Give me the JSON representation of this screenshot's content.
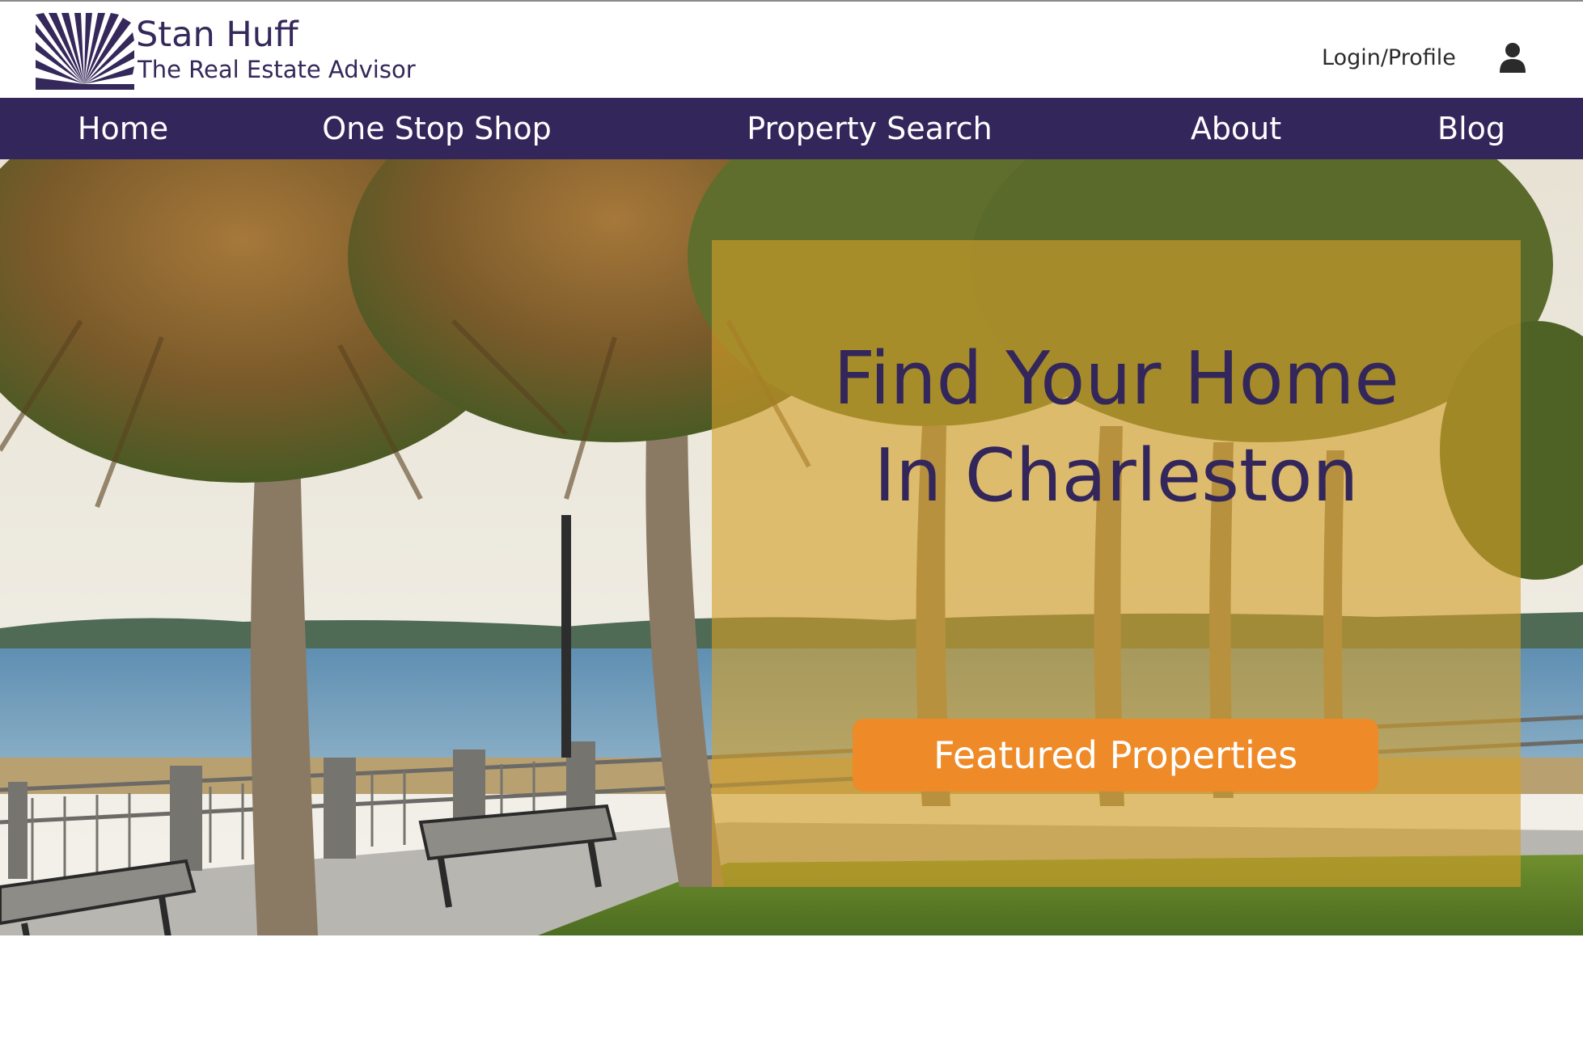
{
  "brand": {
    "name": "Stan Huff",
    "tagline": "The Real Estate Advisor",
    "color": "#35285a"
  },
  "header": {
    "login_label": "Login/Profile",
    "profile_icon": "user-icon"
  },
  "nav": {
    "background": "#33265b",
    "items": [
      {
        "label": "Home"
      },
      {
        "label": "One Stop Shop"
      },
      {
        "label": "Property Search"
      },
      {
        "label": "About"
      },
      {
        "label": "Blog"
      }
    ]
  },
  "hero": {
    "headline_line1": "Find Your Home",
    "headline_line2": "In Charleston",
    "cta_label": "Featured Properties",
    "cta_color": "#ee8a27",
    "overlay_color": "#d4a028"
  }
}
